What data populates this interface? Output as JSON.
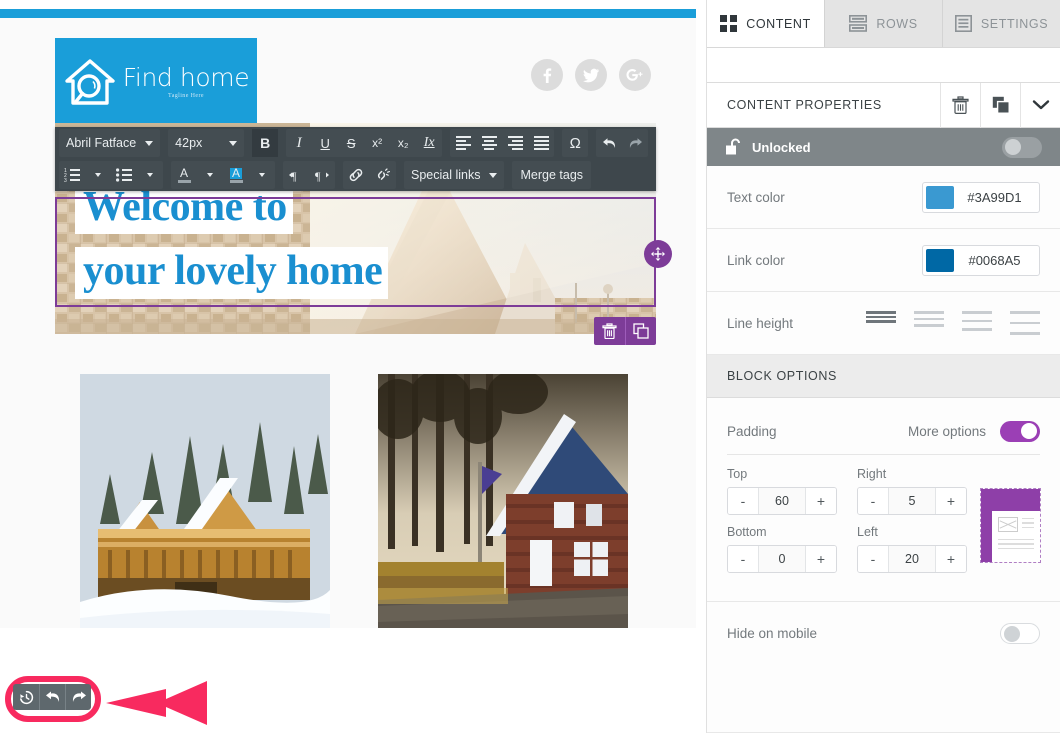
{
  "panel": {
    "tabs": [
      {
        "label": "CONTENT",
        "icon": "grid-icon",
        "active": true
      },
      {
        "label": "ROWS",
        "icon": "rows-icon",
        "active": false
      },
      {
        "label": "SETTINGS",
        "icon": "settings-list-icon",
        "active": false
      }
    ],
    "properties_title": "CONTENT PROPERTIES",
    "actions": {
      "delete": "trash-icon",
      "duplicate": "duplicate-icon",
      "collapse": "chevron-down-icon"
    },
    "lock": {
      "label": "Unlocked",
      "icon": "unlock-icon",
      "enabled": false
    },
    "text_color": {
      "label": "Text color",
      "value": "#3A99D1"
    },
    "link_color": {
      "label": "Link color",
      "value": "#0068A5"
    },
    "line_height": {
      "label": "Line height",
      "options": [
        "tight",
        "normal",
        "relaxed",
        "loose"
      ],
      "selected": 0
    },
    "block_options_title": "BLOCK OPTIONS",
    "padding": {
      "label": "Padding",
      "more_options_label": "More options",
      "more_options_on": true,
      "top": {
        "label": "Top",
        "value": "60"
      },
      "right": {
        "label": "Right",
        "value": "5"
      },
      "bottom": {
        "label": "Bottom",
        "value": "0"
      },
      "left": {
        "label": "Left",
        "value": "20"
      },
      "minus": "-",
      "plus": "+"
    },
    "hide_on_mobile": {
      "label": "Hide on mobile",
      "enabled": false
    }
  },
  "toolbar": {
    "font_family": "Abril Fatface",
    "font_size": "42px",
    "bold": "B",
    "italic": "I",
    "underline": "U",
    "strikethrough": "S",
    "superscript": "x²",
    "subscript": "x₂",
    "clear_format": "Ix",
    "special_char": "Ω",
    "undo": "undo-icon",
    "redo": "redo-icon",
    "numbered_list": "numbered-list-icon",
    "bullet_list": "bullet-list-icon",
    "text_color": "A",
    "highlight_color": "A",
    "ltr": "ltr-icon",
    "rtl": "rtl-icon",
    "link": "link-icon",
    "unlink": "unlink-icon",
    "special_links": "Special links",
    "merge_tags": "Merge tags"
  },
  "email": {
    "logo": {
      "name": "Find home",
      "tagline": "Tagline Here",
      "bg": "#1A9ED9"
    },
    "social": [
      {
        "name": "facebook-icon",
        "glyph": "f"
      },
      {
        "name": "twitter-icon",
        "glyph": "t"
      },
      {
        "name": "googleplus-icon",
        "glyph": "G+"
      }
    ],
    "hero": {
      "line1": "Welcome to",
      "line2": "your lovely home",
      "text_color": "#1A8FD0",
      "highlight": "#FFFFFF"
    },
    "photos": [
      {
        "alt": "snowy-wooden-cabin"
      },
      {
        "alt": "wooden-house-blue-roof"
      }
    ]
  },
  "history": {
    "restore": "history-icon",
    "undo": "undo-arrow-icon",
    "redo": "redo-arrow-icon",
    "highlight_color": "#F82A5F"
  }
}
